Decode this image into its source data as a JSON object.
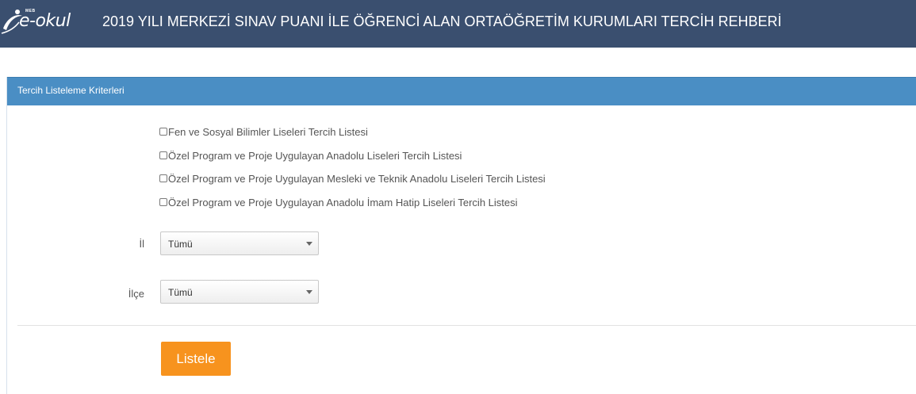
{
  "header": {
    "logo_text": "e-okul",
    "logo_small": "MEB",
    "title": "2019 YILI MERKEZİ SINAV PUANI İLE ÖĞRENCİ ALAN ORTAÖĞRETİM KURUMLARI TERCİH REHBERİ"
  },
  "panel": {
    "title": "Tercih Listeleme Kriterleri"
  },
  "options": [
    {
      "label": "Fen ve Sosyal Bilimler Liseleri Tercih Listesi",
      "checked": false
    },
    {
      "label": "Özel Program ve Proje Uygulayan Anadolu Liseleri Tercih Listesi",
      "checked": false
    },
    {
      "label": "Özel Program ve Proje Uygulayan Mesleki ve Teknik Anadolu Liseleri Tercih Listesi",
      "checked": false
    },
    {
      "label": "Özel Program ve Proje Uygulayan Anadolu İmam Hatip Liseleri Tercih Listesi",
      "checked": false
    }
  ],
  "filters": {
    "il": {
      "label": "İl",
      "value": "Tümü"
    },
    "ilce": {
      "label": "İlçe",
      "value": "Tümü"
    }
  },
  "actions": {
    "list_label": "Listele"
  },
  "colors": {
    "topbar": "#3a4f6f",
    "panel_header": "#4a8ec4",
    "button": "#f7931e"
  }
}
